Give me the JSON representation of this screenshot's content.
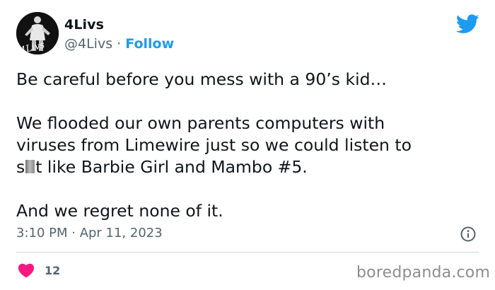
{
  "tweet": {
    "author": {
      "display_name": "4Livs",
      "handle": "@4Livs",
      "avatar_logo_text": "4Livs"
    },
    "separator": "·",
    "follow_label": "Follow",
    "text": {
      "line1": "Be careful before you mess with a 90’s kid…",
      "line2": "We flooded our own parents computers with",
      "line3": "viruses from Limewire just so we could listen to",
      "line4_before": "s",
      "line4_after": "t like Barbie Girl and Mambo #5.",
      "line5": "And we regret none of it."
    },
    "timestamp": "3:10 PM · Apr 11, 2023",
    "likes": "12"
  },
  "icons": {
    "platform": "twitter-bird-icon",
    "info": "info-icon",
    "like": "heart-icon"
  },
  "colors": {
    "link_blue": "#1d9bf0",
    "like_pink": "#f91880",
    "muted_text": "#536471"
  },
  "watermark": "boredpanda.com"
}
